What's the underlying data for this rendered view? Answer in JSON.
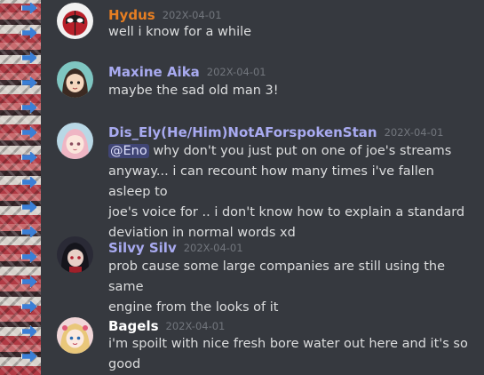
{
  "messages": [
    {
      "author": "Hydus",
      "author_color": "#e67e22",
      "timestamp": "202X-04-01",
      "avatar": "red-mask-avatar",
      "lines": [
        "well i know for a while"
      ]
    },
    {
      "author": "Maxine Aika",
      "author_color": "#a8aaf0",
      "timestamp": "202X-04-01",
      "avatar": "green-hair-girl-avatar",
      "lines": [
        "maybe the sad old man 3!"
      ]
    },
    {
      "author": "Dis_Ely(He/Him)NotAForspokenStan",
      "author_color": "#a8aaf0",
      "timestamp": "202X-04-01",
      "avatar": "pink-hair-girl-avatar",
      "mention": "@Eno",
      "lines": [
        "why don't you just put on one of joe's streams",
        "anyway... i can recount how many times i've fallen asleep to",
        "joe's voice for .. i don't know how to explain a standard",
        "deviation in normal words xd"
      ]
    },
    {
      "author": "Silvy Silv",
      "author_color": "#a8aaf0",
      "timestamp": "202X-04-01",
      "avatar": "dark-hair-girl-avatar",
      "lines": [
        "prob cause some large companies are still using the same",
        "engine from the looks of it"
      ]
    },
    {
      "author": "Bagels",
      "author_color": "#ffffff",
      "timestamp": "202X-04-01",
      "avatar": "blonde-anime-avatar",
      "lines": [
        "i'm spoilt with nice fresh bore water out here and it's so",
        "good"
      ]
    }
  ]
}
